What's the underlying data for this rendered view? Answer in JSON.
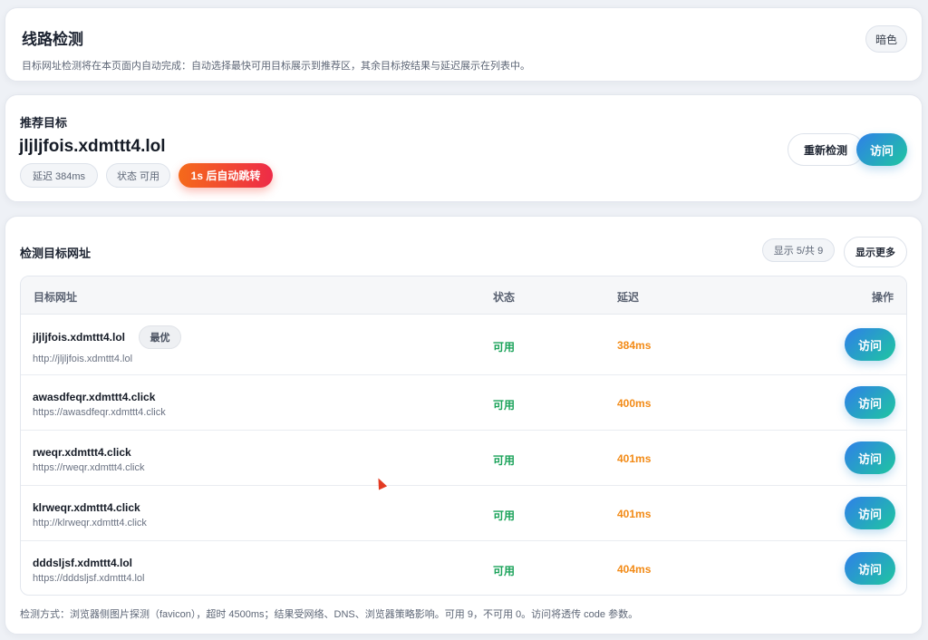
{
  "header": {
    "title": "线路检测",
    "subtitle": "目标网址检测将在本页面内自动完成：自动选择最快可用目标展示到推荐区，其余目标按结果与延迟展示在列表中。",
    "theme_label": "暗色"
  },
  "recommended": {
    "label": "推荐目标",
    "domain": "jljljfois.xdmttt4.lol",
    "latency": "延迟 384ms",
    "status": "状态 可用",
    "auto_redirect": "1s 后自动跳转",
    "recheck_label": "重新检测",
    "visit_label": "访问"
  },
  "list": {
    "title": "检测目标网址",
    "count": "显示 5/共 9",
    "more_label": "显示更多",
    "columns": [
      "目标网址",
      "状态",
      "延迟",
      "操作"
    ],
    "best_badge": "最优",
    "rows": [
      {
        "host": "jljljfois.xdmttt4.lol",
        "url": "http://jljljfois.xdmttt4.lol",
        "status": "可用",
        "latency": "384ms",
        "action": "访问"
      },
      {
        "host": "awasdfeqr.xdmttt4.click",
        "url": "https://awasdfeqr.xdmttt4.click",
        "status": "可用",
        "latency": "400ms",
        "action": "访问"
      },
      {
        "host": "rweqr.xdmttt4.click",
        "url": "https://rweqr.xdmttt4.click",
        "status": "可用",
        "latency": "401ms",
        "action": "访问"
      },
      {
        "host": "klrweqr.xdmttt4.click",
        "url": "http://klrweqr.xdmttt4.click",
        "status": "可用",
        "latency": "401ms",
        "action": "访问"
      },
      {
        "host": "dddsljsf.xdmttt4.lol",
        "url": "https://dddsljsf.xdmttt4.lol",
        "status": "可用",
        "latency": "404ms",
        "action": "访问"
      }
    ],
    "footnote": "检测方式：浏览器侧图片探测（favicon），超时 4500ms；结果受网络、DNS、浏览器策略影响。可用 9，不可用 0。访问将透传 code 参数。"
  },
  "colors": {
    "status_ok": "#1ba35a",
    "latency": "#f28a16",
    "accent_gradient_start": "#2f7fe9",
    "accent_gradient_end": "#1fc6a0",
    "auto_gradient_start": "#f56a1a",
    "auto_gradient_end": "#ee2b48"
  }
}
